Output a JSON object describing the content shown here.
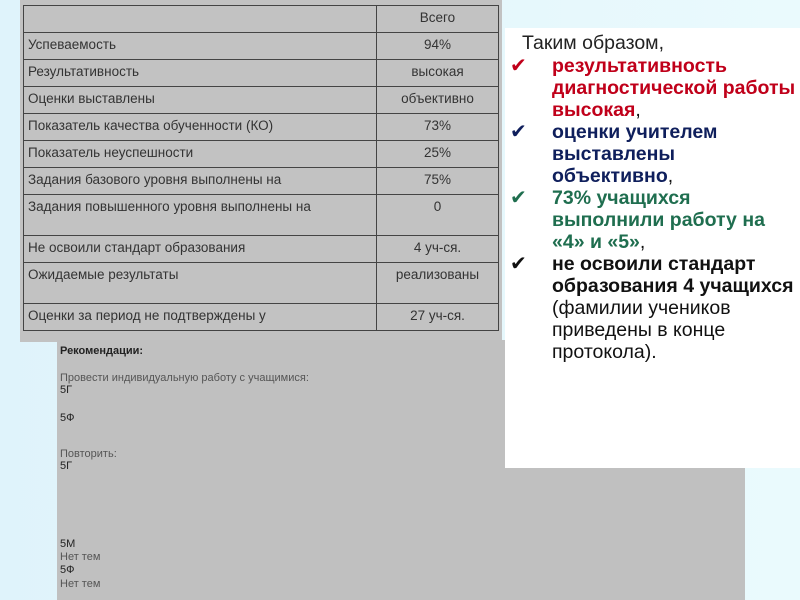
{
  "table": {
    "header": "Всего",
    "rows": [
      {
        "label": "Успеваемость",
        "value": "94%"
      },
      {
        "label": "Результативность",
        "value": "высокая"
      },
      {
        "label": "Оценки выставлены",
        "value": "объективно"
      },
      {
        "label": "Показатель качества обученности (КО)",
        "value": "73%"
      },
      {
        "label": "Показатель неуспешности",
        "value": "25%"
      },
      {
        "label": "Задания базового уровня выполнены на",
        "value": "75%"
      },
      {
        "label": "Задания повышенного уровня выполнены на",
        "value": "0"
      },
      {
        "label": "Не освоили стандарт образования",
        "value": "4 уч-ся."
      },
      {
        "label": "Ожидаемые результаты",
        "value": "реализованы"
      },
      {
        "label": "Оценки за период не подтверждены у",
        "value": "27 уч-ся."
      }
    ]
  },
  "recommendations": {
    "title": "Рекомендации:",
    "individual": "Провести индивидуальную работу с учащимися:",
    "c1": "5Г",
    "c2": "5Ф",
    "repeat": "Повторить:",
    "c3": "5Г",
    "c4": "5М",
    "n1": "Нет тем",
    "c5": "5Ф",
    "n2": "Нет тем"
  },
  "conclusion": {
    "intro": "Таким образом,",
    "items": [
      {
        "text": "результативность диагностической работы высокая",
        "tail": ",",
        "color": "#c0001a"
      },
      {
        "text": "оценки учителем выставлены объективно",
        "tail": ",",
        "color": "#0f1f5c"
      },
      {
        "text": "73% учащихся выполнили работу на «4» и «5»",
        "tail": ",",
        "color": "#1f6e4f"
      },
      {
        "text": "не освоили стандарт образования 4 учащихся",
        "tail": " (фамилии учеников приведены в конце протокола).",
        "color": "#111111"
      }
    ]
  }
}
